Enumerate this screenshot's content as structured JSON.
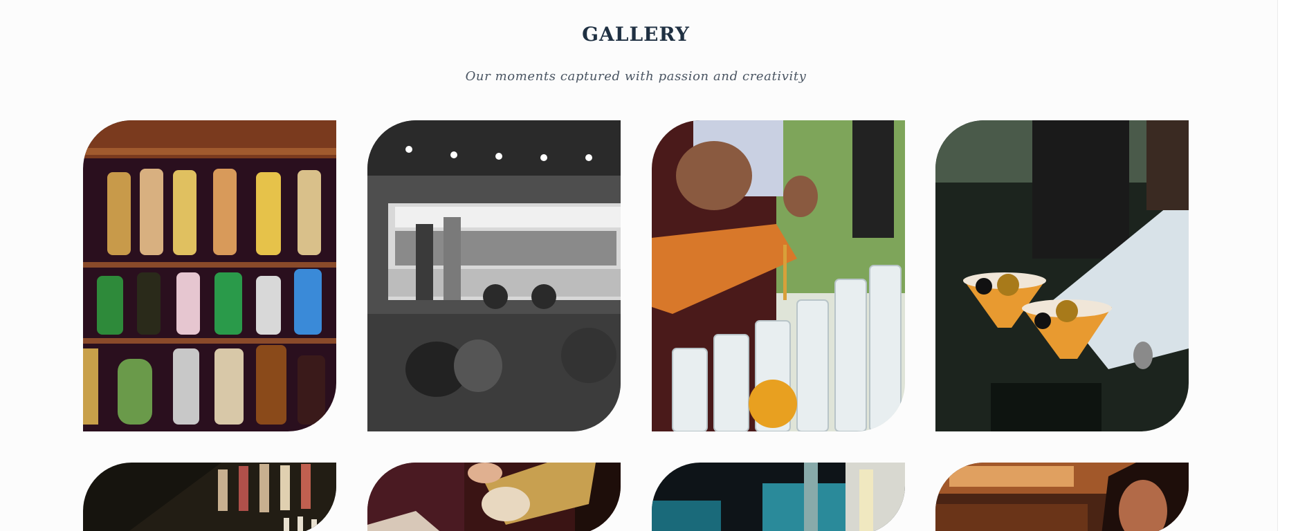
{
  "gallery": {
    "title": "GALLERY",
    "subtitle": "Our moments captured with passion and creativity"
  },
  "photos": [
    {
      "name": "bar-bottles-photo",
      "description": "Shelves of liquor bottles"
    },
    {
      "name": "food-truck-event-photo",
      "description": "Black and white outdoor event with food truck"
    },
    {
      "name": "pouring-drink-photo",
      "description": "Pouring orange drink into glasses"
    },
    {
      "name": "cocktails-photo",
      "description": "Bartender holding two passion fruit cocktails"
    },
    {
      "name": "bar-shelves-photo",
      "description": "Dark bar shelves"
    },
    {
      "name": "cocktail-shaker-photo",
      "description": "Bartender with shaker"
    },
    {
      "name": "bar-lights-photo",
      "description": "Bar with blue lights"
    },
    {
      "name": "bartender-closeup-photo",
      "description": "Bartender close-up"
    }
  ]
}
